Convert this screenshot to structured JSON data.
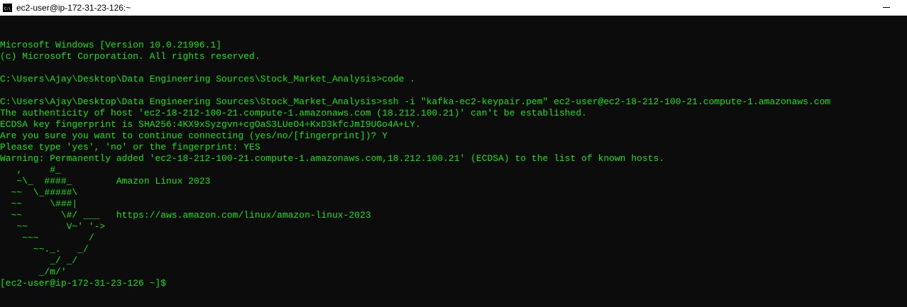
{
  "window": {
    "title": "ec2-user@ip-172-31-23-126:~",
    "icon": "cmd-icon",
    "colors": {
      "background": "#0c0c0c",
      "text": "#13e413",
      "titlebar": "#ffffff"
    }
  },
  "console": {
    "lines": [
      "Microsoft Windows [Version 10.0.21996.1]",
      "(c) Microsoft Corporation. All rights reserved.",
      "",
      "C:\\Users\\Ajay\\Desktop\\Data Engineering Sources\\Stock_Market_Analysis>code .",
      "",
      "C:\\Users\\Ajay\\Desktop\\Data Engineering Sources\\Stock_Market_Analysis>ssh -i \"kafka-ec2-keypair.pem\" ec2-user@ec2-18-212-100-21.compute-1.amazonaws.com",
      "The authenticity of host 'ec2-18-212-100-21.compute-1.amazonaws.com (18.212.100.21)' can't be established.",
      "ECDSA key fingerprint is SHA256:4KX9xSyzgvn+cgOaS3LUeO4+KxD3kfcJmI9UGo4A+LY.",
      "Are you sure you want to continue connecting (yes/no/[fingerprint])? Y",
      "Please type 'yes', 'no' or the fingerprint: YES",
      "Warning: Permanently added 'ec2-18-212-100-21.compute-1.amazonaws.com,18.212.100.21' (ECDSA) to the list of known hosts.",
      "   ,     #_",
      "   ~\\_  ####_        Amazon Linux 2023",
      "  ~~  \\_#####\\",
      "  ~~     \\###|",
      "  ~~       \\#/ ___   https://aws.amazon.com/linux/amazon-linux-2023",
      "   ~~       V~' '->",
      "    ~~~         /",
      "      ~~._.   _/",
      "         _/ _/",
      "       _/m/'"
    ],
    "prompt": "[ec2-user@ip-172-31-23-126 ~]$"
  }
}
